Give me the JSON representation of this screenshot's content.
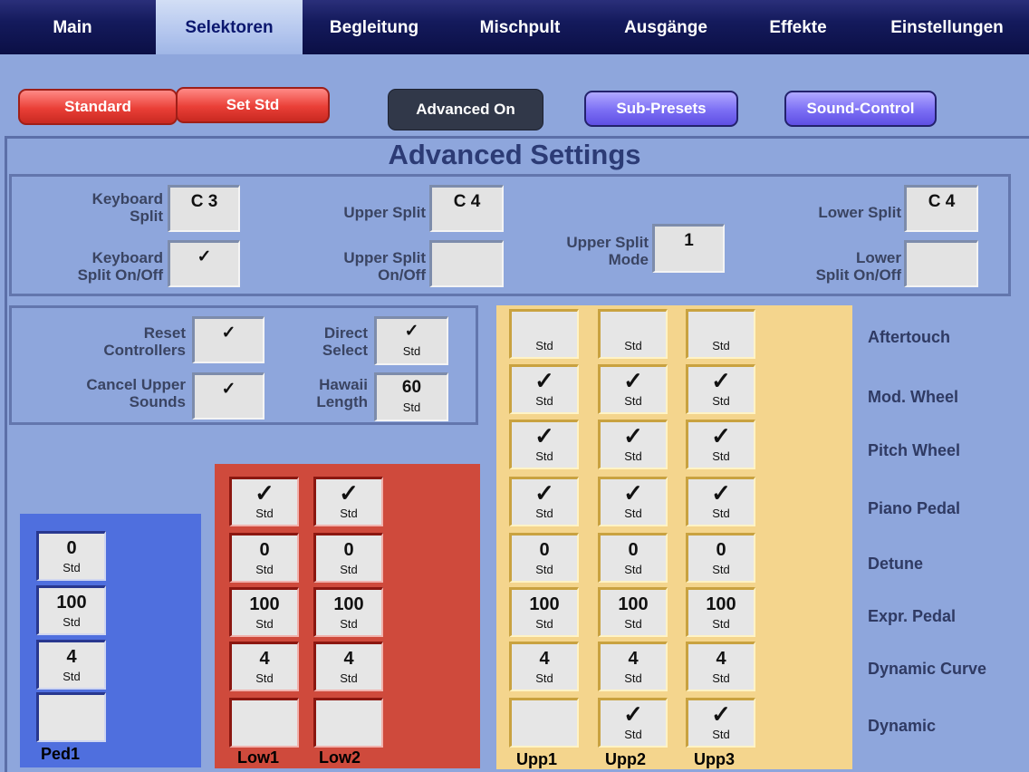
{
  "tabs": [
    "Main",
    "Selektoren",
    "Begleitung",
    "Mischpult",
    "Ausgänge",
    "Effekte",
    "Einstellungen"
  ],
  "buttons": {
    "standard": "Standard",
    "set_std": "Set Std",
    "advanced_on": "Advanced On",
    "sub_presets": "Sub-Presets",
    "sound_control": "Sound-Control"
  },
  "title": "Advanced Settings",
  "split": {
    "kb_split_label_1": "Keyboard",
    "kb_split_label_2": "Split",
    "kb_split_value": "C 3",
    "kb_onoff_label_1": "Keyboard",
    "kb_onoff_label_2": "Split On/Off",
    "kb_onoff_value": "✓",
    "upper_split_label": "Upper Split",
    "upper_split_value": "C 4",
    "upper_onoff_label_1": "Upper Split",
    "upper_onoff_label_2": "On/Off",
    "upper_onoff_value": "",
    "upper_mode_label_1": "Upper Split",
    "upper_mode_label_2": "Mode",
    "upper_mode_value": "1",
    "lower_split_label": "Lower Split",
    "lower_split_value": "C 4",
    "lower_onoff_label_1": "Lower",
    "lower_onoff_label_2": "Split On/Off",
    "lower_onoff_value": ""
  },
  "options": {
    "reset_label_1": "Reset",
    "reset_label_2": "Controllers",
    "reset_value": "✓",
    "cancel_label_1": "Cancel Upper",
    "cancel_label_2": "Sounds",
    "cancel_value": "✓",
    "direct_label_1": "Direct",
    "direct_label_2": "Select",
    "direct_value": "✓",
    "direct_sub": "Std",
    "hawaii_label_1": "Hawaii",
    "hawaii_label_2": "Length",
    "hawaii_value": "60",
    "hawaii_sub": "Std"
  },
  "row_labels": [
    "Aftertouch",
    "Mod. Wheel",
    "Pitch Wheel",
    "Piano Pedal",
    "Detune",
    "Expr. Pedal",
    "Dynamic Curve",
    "Dynamic"
  ],
  "column_labels": {
    "ped1": "Ped1",
    "low1": "Low1",
    "low2": "Low2",
    "upp1": "Upp1",
    "upp2": "Upp2",
    "upp3": "Upp3"
  },
  "grid": {
    "ped1": [
      {
        "main": "0",
        "sub": "Std"
      },
      {
        "main": "100",
        "sub": "Std"
      },
      {
        "main": "4",
        "sub": "Std"
      },
      {
        "main": "",
        "sub": ""
      }
    ],
    "low1": [
      {
        "main": "✓",
        "sub": "Std"
      },
      {
        "main": "0",
        "sub": "Std"
      },
      {
        "main": "100",
        "sub": "Std"
      },
      {
        "main": "4",
        "sub": "Std"
      },
      {
        "main": "",
        "sub": ""
      }
    ],
    "low2": [
      {
        "main": "✓",
        "sub": "Std"
      },
      {
        "main": "0",
        "sub": "Std"
      },
      {
        "main": "100",
        "sub": "Std"
      },
      {
        "main": "4",
        "sub": "Std"
      },
      {
        "main": "",
        "sub": ""
      }
    ],
    "upp1": [
      {
        "main": "",
        "sub": "Std"
      },
      {
        "main": "✓",
        "sub": "Std"
      },
      {
        "main": "✓",
        "sub": "Std"
      },
      {
        "main": "✓",
        "sub": "Std"
      },
      {
        "main": "0",
        "sub": "Std"
      },
      {
        "main": "100",
        "sub": "Std"
      },
      {
        "main": "4",
        "sub": "Std"
      },
      {
        "main": "",
        "sub": ""
      }
    ],
    "upp2": [
      {
        "main": "",
        "sub": "Std"
      },
      {
        "main": "✓",
        "sub": "Std"
      },
      {
        "main": "✓",
        "sub": "Std"
      },
      {
        "main": "✓",
        "sub": "Std"
      },
      {
        "main": "0",
        "sub": "Std"
      },
      {
        "main": "100",
        "sub": "Std"
      },
      {
        "main": "4",
        "sub": "Std"
      },
      {
        "main": "✓",
        "sub": "Std"
      }
    ],
    "upp3": [
      {
        "main": "",
        "sub": "Std"
      },
      {
        "main": "✓",
        "sub": "Std"
      },
      {
        "main": "✓",
        "sub": "Std"
      },
      {
        "main": "✓",
        "sub": "Std"
      },
      {
        "main": "0",
        "sub": "Std"
      },
      {
        "main": "100",
        "sub": "Std"
      },
      {
        "main": "4",
        "sub": "Std"
      },
      {
        "main": "✓",
        "sub": "Std"
      }
    ]
  },
  "colors": {
    "ped": "#4f6fde",
    "low": "#cf4a3c",
    "upp": "#f4d58d",
    "tabbar": "#141a5c"
  }
}
